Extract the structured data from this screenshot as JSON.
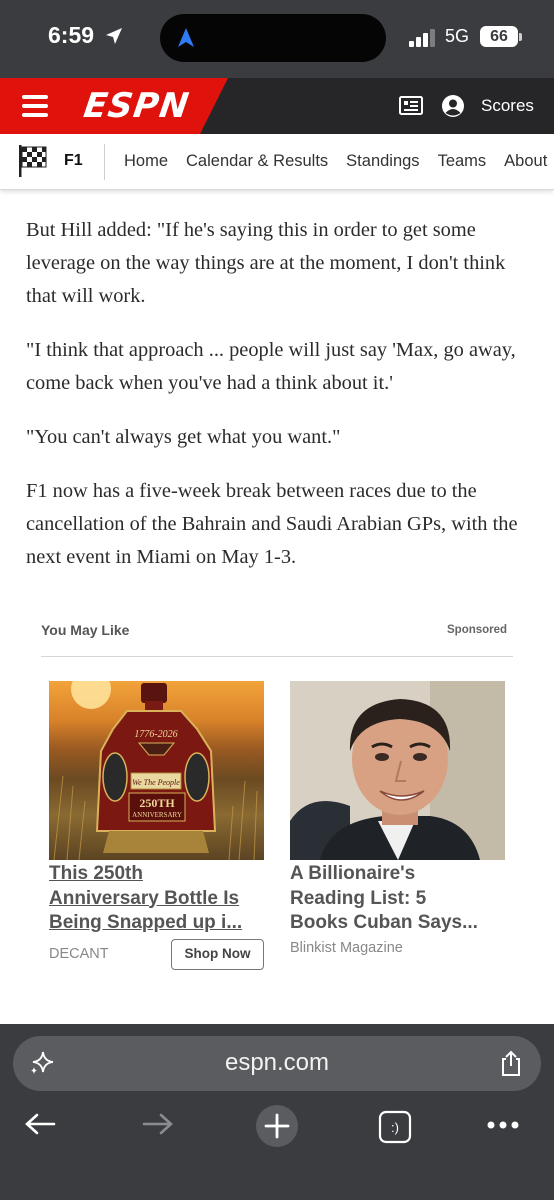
{
  "status_bar": {
    "time": "6:59",
    "network": "5G",
    "battery": "66"
  },
  "header": {
    "logo": "ESPN",
    "scores_label": "Scores"
  },
  "subnav": {
    "section": "F1",
    "links": [
      "Home",
      "Calendar & Results",
      "Standings",
      "Teams",
      "About"
    ]
  },
  "article": {
    "paragraphs": [
      "But Hill added: \"If he's saying this in order to get some leverage on the way things are at the moment, I don't think that will work.",
      "\"I think that approach ... people will just say 'Max, go away, come back when you've had a think about it.'",
      "\"You can't always get what you want.\"",
      "F1 now has a five-week break between races due to the cancellation of the Bahrain and Saudi Arabian GPs, with the next event in Miami on May 1-3."
    ]
  },
  "recommendations": {
    "heading": "You May Like",
    "sponsored_label": "Sponsored",
    "cards": [
      {
        "title_lines": [
          "This 250th",
          "Anniversary Bottle Is",
          "Being Snapped up i..."
        ],
        "source": "DECANT",
        "cta": "Shop Now",
        "image_text": [
          "1776-2026",
          "We The People",
          "250TH",
          "ANNIVERSARY"
        ]
      },
      {
        "title_lines": [
          "A Billionaire's",
          "Reading List: 5",
          "Books Cuban Says..."
        ],
        "source": "Blinkist Magazine"
      }
    ]
  },
  "browser": {
    "url": "espn.com"
  },
  "colors": {
    "espn_red": "#e0120c",
    "header_dark": "#262628",
    "chrome": "#3a3c3f"
  }
}
